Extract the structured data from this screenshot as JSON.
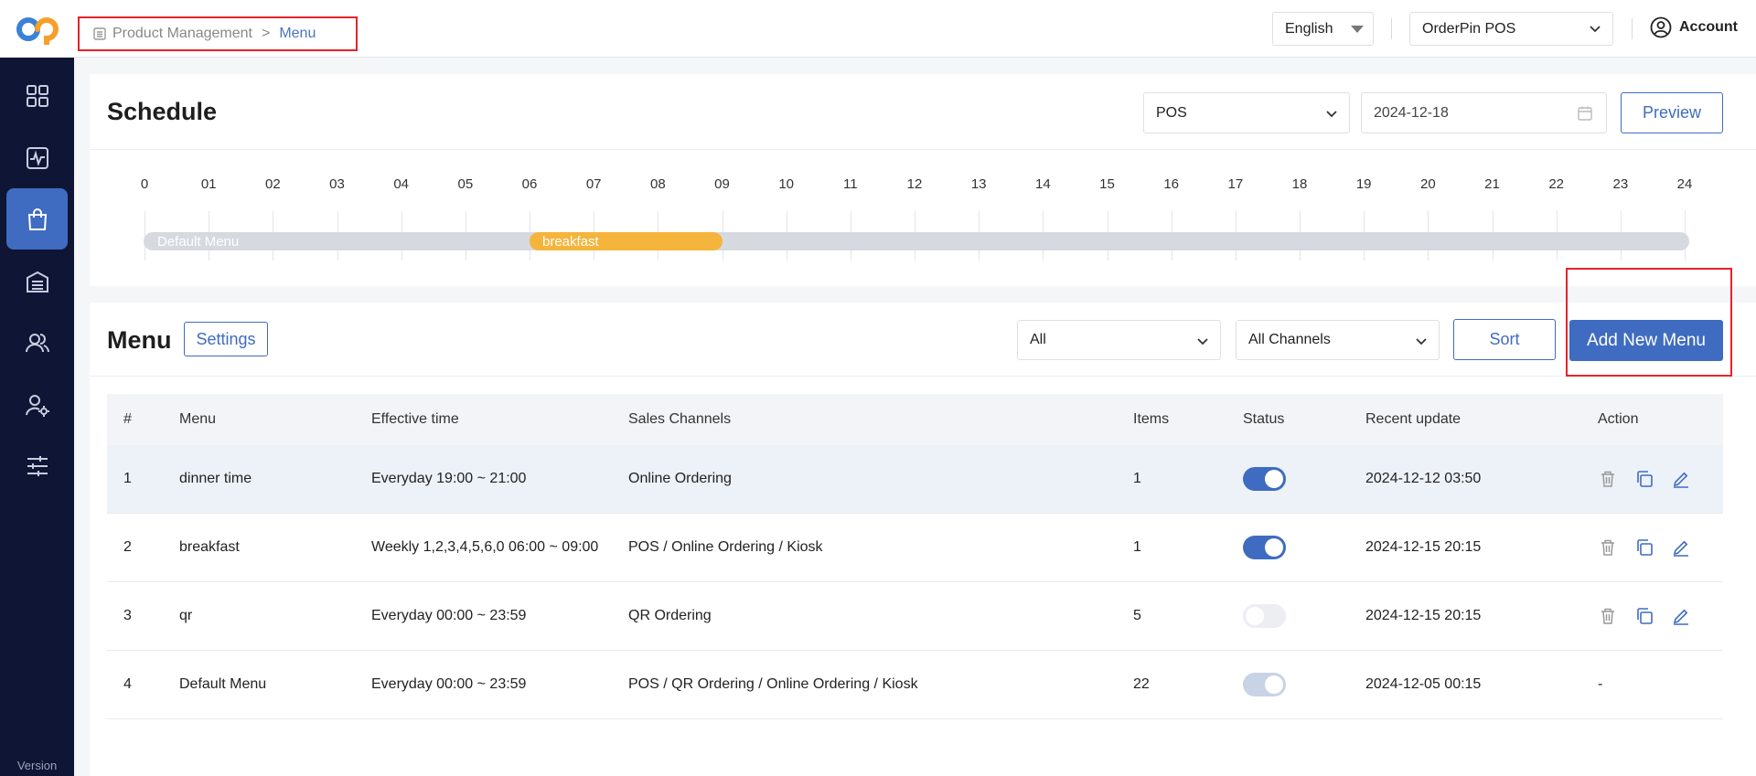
{
  "nav": {
    "version_label": "Version",
    "items": [
      "dashboard-icon",
      "analytics-icon",
      "product-bag-icon",
      "inventory-icon",
      "customers-icon",
      "staff-settings-icon",
      "settings-sliders-icon"
    ],
    "active_index": 2
  },
  "topbar": {
    "breadcrumb": {
      "parent": "Product Management",
      "separator": ">",
      "current": "Menu"
    },
    "language": "English",
    "store": "OrderPin POS",
    "account_label": "Account"
  },
  "schedule": {
    "title": "Schedule",
    "channel_select": "POS",
    "date": "2024-12-18",
    "preview_label": "Preview",
    "hours": [
      "0",
      "01",
      "02",
      "03",
      "04",
      "05",
      "06",
      "07",
      "08",
      "09",
      "10",
      "11",
      "12",
      "13",
      "14",
      "15",
      "16",
      "17",
      "18",
      "19",
      "20",
      "21",
      "22",
      "23",
      "24"
    ],
    "segments": [
      {
        "name": "Default Menu",
        "start": 0,
        "end": 24
      },
      {
        "name": "breakfast",
        "start": 6,
        "end": 9
      }
    ]
  },
  "menu": {
    "title": "Menu",
    "settings_label": "Settings",
    "status_filter": "All",
    "channel_filter": "All Channels",
    "sort_label": "Sort",
    "add_label": "Add New Menu",
    "columns": [
      "#",
      "Menu",
      "Effective time",
      "Sales Channels",
      "Items",
      "Status",
      "Recent update",
      "Action"
    ],
    "rows": [
      {
        "index": "1",
        "name": "dinner time",
        "time": "Everyday  19:00 ~ 21:00",
        "channels": "Online Ordering",
        "items": "1",
        "status": "on",
        "updated": "2024-12-12 03:50",
        "actions": true
      },
      {
        "index": "2",
        "name": "breakfast",
        "time": "Weekly 1,2,3,4,5,6,0  06:00 ~ 09:00",
        "channels": "POS / Online Ordering / Kiosk",
        "items": "1",
        "status": "on",
        "updated": "2024-12-15 20:15",
        "actions": true
      },
      {
        "index": "3",
        "name": "qr",
        "time": "Everyday  00:00 ~ 23:59",
        "channels": "QR Ordering",
        "items": "5",
        "status": "off",
        "updated": "2024-12-15 20:15",
        "actions": true
      },
      {
        "index": "4",
        "name": "Default Menu",
        "time": "Everyday  00:00 ~ 23:59",
        "channels": "POS / QR Ordering / Online Ordering / Kiosk",
        "items": "22",
        "status": "disabled-on",
        "updated": "2024-12-05 00:15",
        "actions": false,
        "action_placeholder": "-"
      }
    ]
  },
  "colors": {
    "sidebar": "#0f1535",
    "accent": "#3f6cc0",
    "breakfast": "#f5b43b",
    "highlight": "#e5232b"
  }
}
